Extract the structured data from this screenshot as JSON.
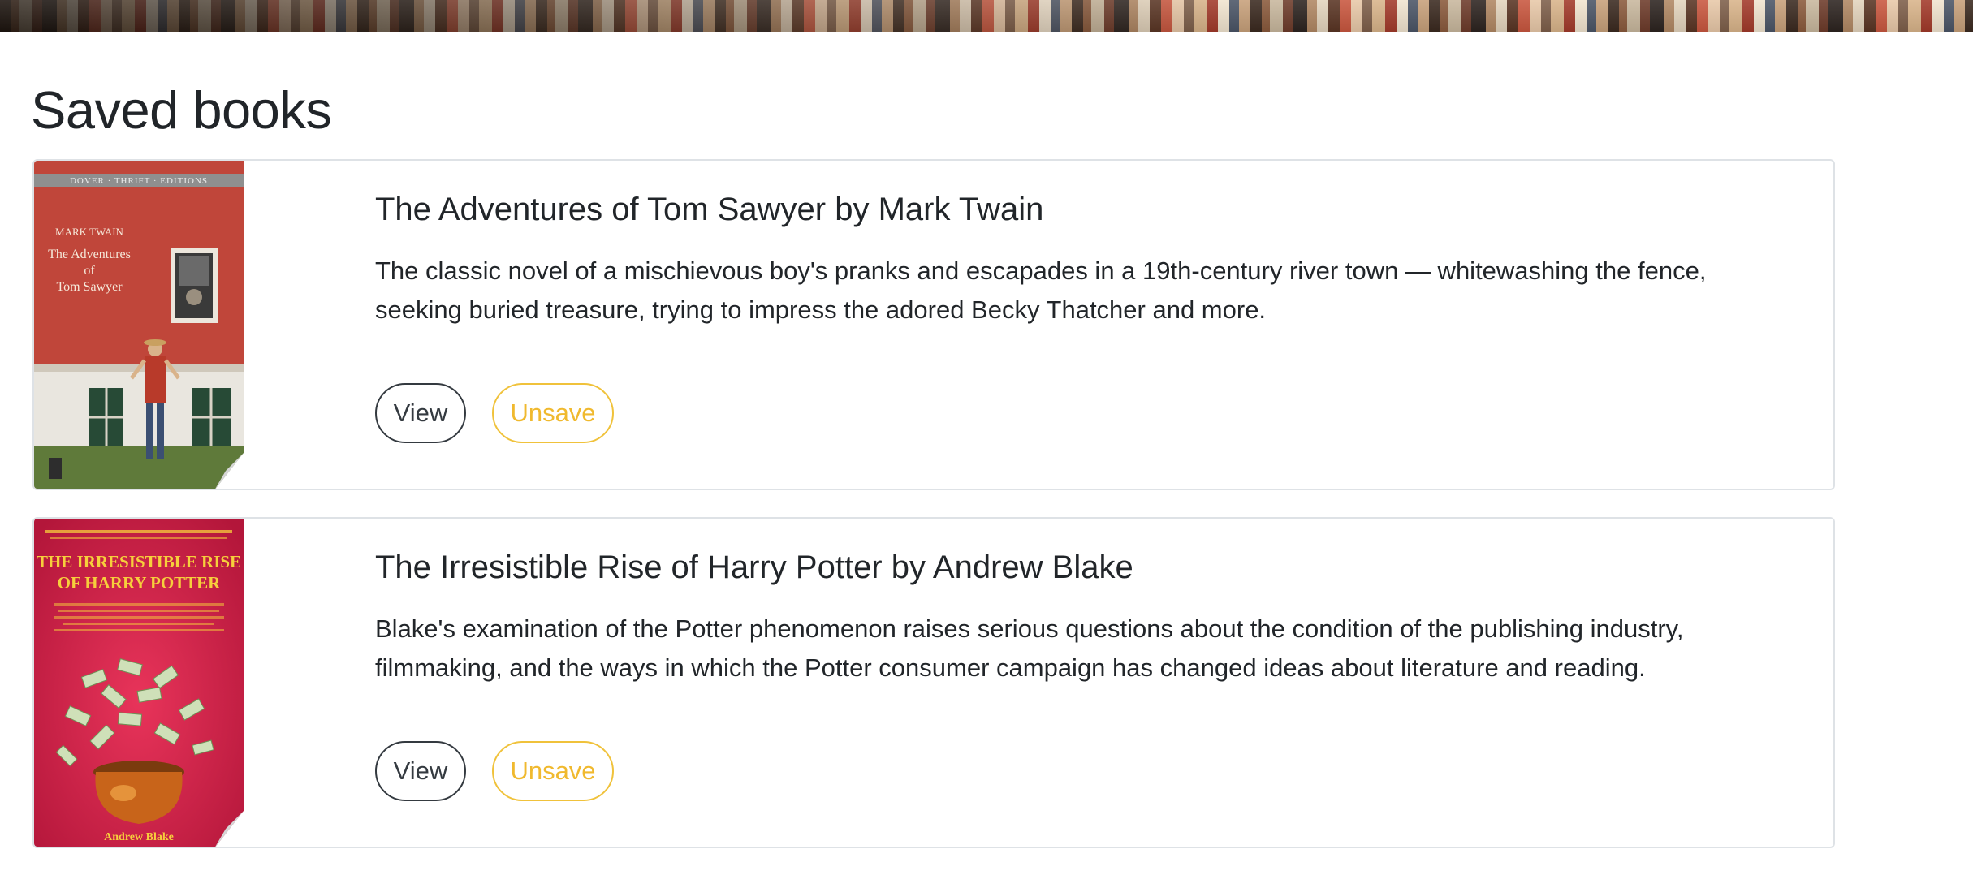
{
  "page": {
    "title": "Saved books"
  },
  "colors": {
    "view_border": "#343a40",
    "unsave_accent": "#f0b92e",
    "card_border": "#dee2e6"
  },
  "books": [
    {
      "title": "The Adventures of Tom Sawyer by Mark Twain",
      "description": "The classic novel of a mischievous boy's pranks and escapades in a 19th-century river town — whitewashing the fence, seeking buried treasure, trying to impress the adored Becky Thatcher and more.",
      "view_label": "View",
      "unsave_label": "Unsave",
      "cover": {
        "series": "DOVER · THRIFT · EDITIONS",
        "author": "MARK TWAIN",
        "title_lines": [
          "The Adventures",
          "of",
          "Tom Sawyer"
        ]
      }
    },
    {
      "title": "The Irresistible Rise of Harry Potter by Andrew Blake",
      "description": "Blake's examination of the Potter phenomenon raises serious questions about the condition of the publishing industry, filmmaking, and the ways in which the Potter consumer campaign has changed ideas about literature and reading.",
      "view_label": "View",
      "unsave_label": "Unsave",
      "cover": {
        "title_lines": [
          "THE IRRESISTIBLE RISE",
          "OF HARRY POTTER"
        ],
        "author": "Andrew Blake"
      }
    }
  ]
}
